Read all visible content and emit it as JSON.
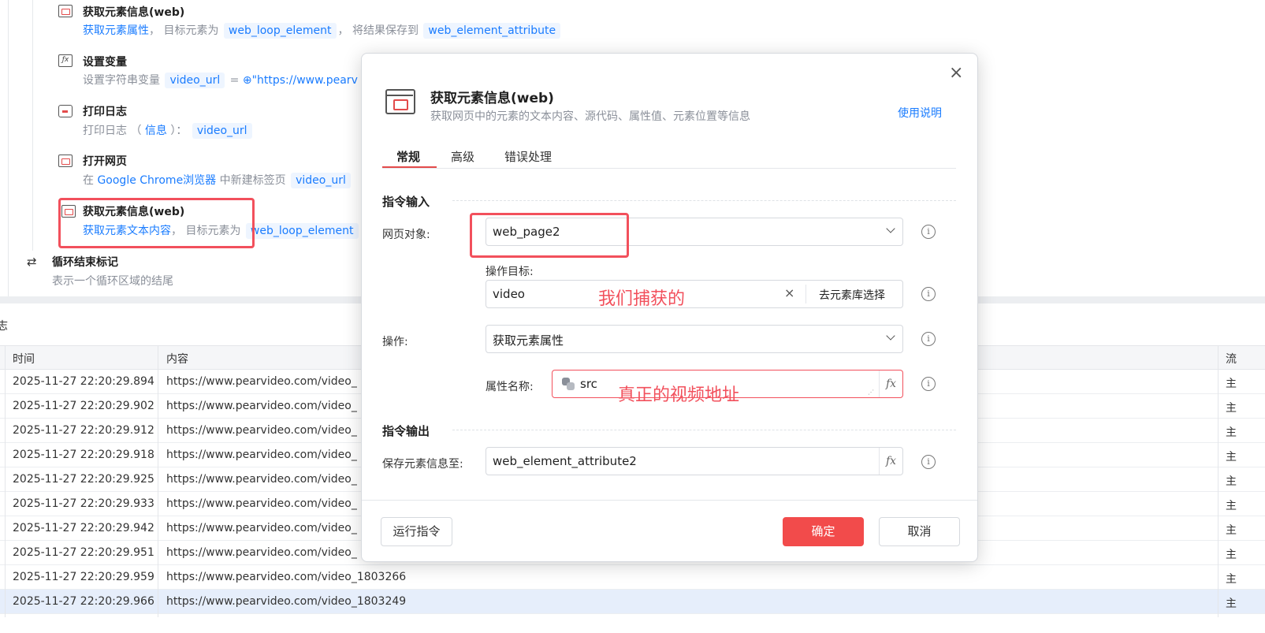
{
  "flow": {
    "steps": [
      {
        "title": "获取元素信息(web)",
        "desc": [
          {
            "t": "获取元素属性",
            "c": "link"
          },
          {
            "t": "， 目标元素为 ",
            "c": "muted"
          },
          {
            "t": "web_loop_element",
            "c": "tag"
          },
          {
            "t": "， 将结果保存到 ",
            "c": "muted"
          },
          {
            "t": "web_element_attribute",
            "c": "tag"
          }
        ]
      },
      {
        "title": "设置变量",
        "desc": [
          {
            "t": "设置字符串变量 ",
            "c": "muted"
          },
          {
            "t": "video_url",
            "c": "tag"
          },
          {
            "t": " = ",
            "c": "muted"
          },
          {
            "t": "⊕\"https://www.pearv",
            "c": "link"
          }
        ]
      },
      {
        "title": "打印日志",
        "desc": [
          {
            "t": "打印日志 （ ",
            "c": "muted"
          },
          {
            "t": "信息",
            "c": "link"
          },
          {
            "t": " ）： ",
            "c": "muted"
          },
          {
            "t": "video_url",
            "c": "tag"
          }
        ]
      },
      {
        "title": "打开网页",
        "desc": [
          {
            "t": "在 ",
            "c": "muted"
          },
          {
            "t": "Google Chrome浏览器",
            "c": "link"
          },
          {
            "t": " 中新建标签页 ",
            "c": "muted"
          },
          {
            "t": "video_url",
            "c": "tag"
          }
        ]
      },
      {
        "title": "获取元素信息(web)",
        "desc": [
          {
            "t": "获取元素文本内容",
            "c": "link"
          },
          {
            "t": "， 目标元素为 ",
            "c": "muted"
          },
          {
            "t": "web_loop_element",
            "c": "tag"
          }
        ]
      }
    ],
    "loop_end": {
      "title": "循环结束标记",
      "desc": "表示一个循环区域的结尾"
    }
  },
  "log": {
    "title": "志",
    "headers": {
      "time": "时间",
      "content": "内容",
      "flow": "流"
    },
    "rows": [
      {
        "time": "2025-11-27 22:20:29.894",
        "content": "https://www.pearvideo.com/video_",
        "flow": "主"
      },
      {
        "time": "2025-11-27 22:20:29.902",
        "content": "https://www.pearvideo.com/video_",
        "flow": "主"
      },
      {
        "time": "2025-11-27 22:20:29.912",
        "content": "https://www.pearvideo.com/video_",
        "flow": "主"
      },
      {
        "time": "2025-11-27 22:20:29.918",
        "content": "https://www.pearvideo.com/video_",
        "flow": "主"
      },
      {
        "time": "2025-11-27 22:20:29.925",
        "content": "https://www.pearvideo.com/video_",
        "flow": "主"
      },
      {
        "time": "2025-11-27 22:20:29.933",
        "content": "https://www.pearvideo.com/video_",
        "flow": "主"
      },
      {
        "time": "2025-11-27 22:20:29.942",
        "content": "https://www.pearvideo.com/video_",
        "flow": "主"
      },
      {
        "time": "2025-11-27 22:20:29.951",
        "content": "https://www.pearvideo.com/video_",
        "flow": "主"
      },
      {
        "time": "2025-11-27 22:20:29.959",
        "content": "https://www.pearvideo.com/video_1803266",
        "flow": "主"
      },
      {
        "time": "2025-11-27 22:20:29.966",
        "content": "https://www.pearvideo.com/video_1803249",
        "flow": "主"
      }
    ],
    "selected_row": 9
  },
  "dialog": {
    "title": "获取元素信息(web)",
    "subtitle": "获取网页中的元素的文本内容、源代码、属性值、元素位置等信息",
    "help": "使用说明",
    "close": "×",
    "tabs": [
      "常规",
      "高级",
      "错误处理"
    ],
    "active_tab": 0,
    "input_section": "指令输入",
    "output_section": "指令输出",
    "page_label": "网页对象:",
    "page_value": "web_page2",
    "target_label": "操作目标:",
    "target_value": "video",
    "target_clear": "×",
    "target_select": "去元素库选择",
    "op_label": "操作:",
    "op_value": "获取元素属性",
    "attr_label": "属性名称:",
    "attr_value": "src",
    "save_label": "保存元素信息至:",
    "save_value": "web_element_attribute2",
    "fx": "fx",
    "info": "i",
    "run_button": "运行指令",
    "ok_button": "确定",
    "cancel_button": "取消",
    "annot_captured": "我们捕获的",
    "annot_real": "真正的视频地址"
  },
  "colors": {
    "accent": "#1a7cff",
    "danger": "#f24b4b",
    "annotation": "#f2505c"
  }
}
